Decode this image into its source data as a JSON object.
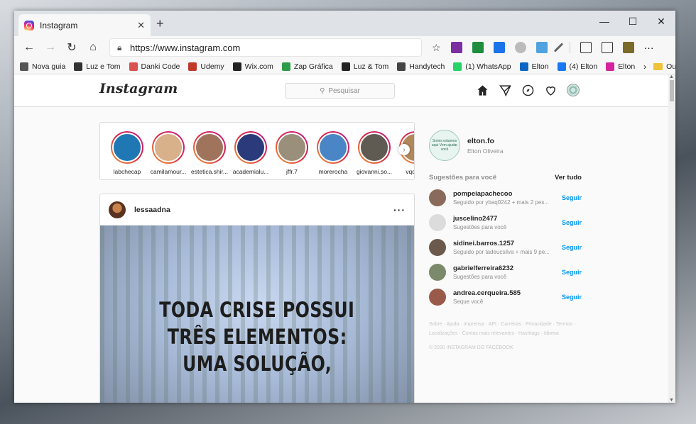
{
  "browser": {
    "tab_title": "Instagram",
    "url": "https://www.instagram.com",
    "bookmarks": [
      {
        "label": "Nova guia",
        "color": "#555555"
      },
      {
        "label": "Luz e Tom",
        "color": "#333333"
      },
      {
        "label": "Danki Code",
        "color": "#d9534f"
      },
      {
        "label": "Udemy",
        "color": "#c0392b"
      },
      {
        "label": "Wix.com",
        "color": "#222222"
      },
      {
        "label": "Zap Gráfica",
        "color": "#2e9d4a"
      },
      {
        "label": "Luz & Tom",
        "color": "#222222"
      },
      {
        "label": "Handytech",
        "color": "#444444"
      },
      {
        "label": "(1) WhatsApp",
        "color": "#25d366"
      },
      {
        "label": "Elton",
        "color": "#0a66c2"
      },
      {
        "label": "(4) Elton",
        "color": "#1877f2"
      },
      {
        "label": "Elton",
        "color": "#d6249f"
      }
    ],
    "other_favorites": "Outros favoritos"
  },
  "instagram": {
    "logo": "Instagram",
    "search_placeholder": "Pesquisar",
    "stories": [
      {
        "name": "labchecap",
        "color": "#1f77b4"
      },
      {
        "name": "camilamour...",
        "color": "#d8b08a"
      },
      {
        "name": "estetica.shir...",
        "color": "#a0745c"
      },
      {
        "name": "academialu...",
        "color": "#2b3a7a"
      },
      {
        "name": "jffr.7",
        "color": "#9a8f7a"
      },
      {
        "name": "morerocha",
        "color": "#4a86c5"
      },
      {
        "name": "giovanni.so...",
        "color": "#5f5a52"
      },
      {
        "name": "vqdece",
        "color": "#b0885a"
      }
    ],
    "post": {
      "user": "lessaadna",
      "quote_lines": [
        "TODA CRISE POSSUI",
        "TRÊS ELEMENTOS:",
        "UMA SOLUÇÃO,"
      ]
    },
    "profile": {
      "avatar_text": "Somis estamos aqui Vem ajudar você",
      "username": "elton.fo",
      "fullname": "Elton Oliveira"
    },
    "suggestions_title": "Sugestões para você",
    "see_all": "Ver tudo",
    "follow_label": "Seguir",
    "suggestions": [
      {
        "name": "pompeiapachecoo",
        "desc": "Seguido por ybaq0242 + mais 2 pes...",
        "color": "#8a6a5a"
      },
      {
        "name": "juscelino2477",
        "desc": "Sugestões para você",
        "color": "#dcdcdc"
      },
      {
        "name": "sidinei.barros.1257",
        "desc": "Seguido por tadeucsilva + mais 9 pe...",
        "color": "#6b5a4b"
      },
      {
        "name": "gabrielferreira6232",
        "desc": "Sugestões para você",
        "color": "#7a8a6a"
      },
      {
        "name": "andrea.cerqueira.585",
        "desc": "Seque você",
        "color": "#9a5a4a"
      }
    ],
    "footer_links": "Sobre · Ajuda · Imprensa · API · Carreiras · Privacidade · Termos · Localizações · Contas mais relevantes · Hashtags · Idioma",
    "copyright": "© 2020 INSTAGRAM DO FACEBOOK"
  }
}
